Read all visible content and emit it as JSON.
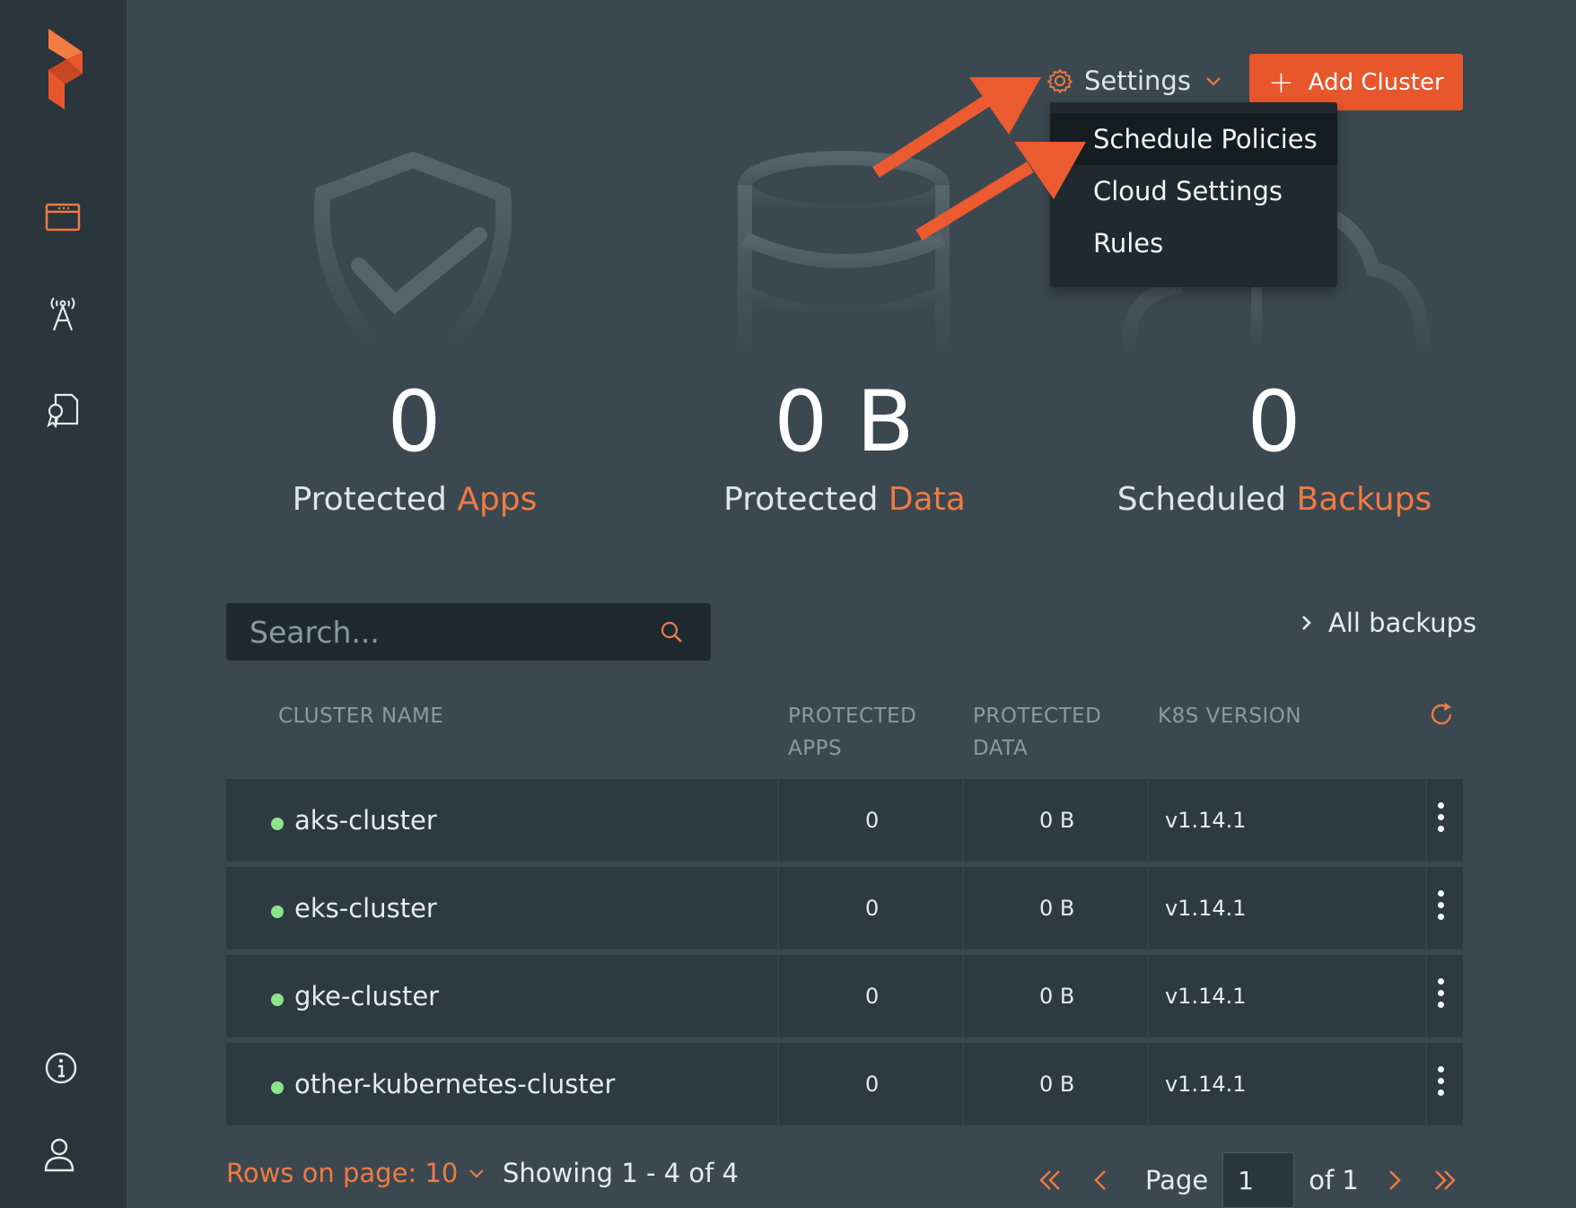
{
  "header": {
    "settings_label": "Settings",
    "add_cluster_label": "Add Cluster"
  },
  "settings_menu": {
    "items": [
      {
        "label": "Schedule Policies"
      },
      {
        "label": "Cloud Settings"
      },
      {
        "label": "Rules"
      }
    ]
  },
  "stats": [
    {
      "value": "0",
      "label_prefix": "Protected ",
      "label_accent": "Apps"
    },
    {
      "value": "0 B",
      "label_prefix": "Protected ",
      "label_accent": "Data"
    },
    {
      "value": "0",
      "label_prefix": "Scheduled ",
      "label_accent": "Backups"
    }
  ],
  "search": {
    "placeholder": "Search..."
  },
  "all_backups_label": "All backups",
  "table": {
    "headers": {
      "cluster_name": "CLUSTER NAME",
      "protected_apps_1": "PROTECTED",
      "protected_apps_2": "APPS",
      "protected_data_1": "PROTECTED",
      "protected_data_2": "DATA",
      "k8s_version": "K8S VERSION"
    },
    "rows": [
      {
        "name": "aks-cluster",
        "apps": "0",
        "data": "0 B",
        "version": "v1.14.1"
      },
      {
        "name": "eks-cluster",
        "apps": "0",
        "data": "0 B",
        "version": "v1.14.1"
      },
      {
        "name": "gke-cluster",
        "apps": "0",
        "data": "0 B",
        "version": "v1.14.1"
      },
      {
        "name": "other-kubernetes-cluster",
        "apps": "0",
        "data": "0 B",
        "version": "v1.14.1"
      }
    ]
  },
  "footer": {
    "rows_on_page": "Rows on page: 10",
    "showing": "Showing 1 - 4 of 4",
    "page_label": "Page",
    "page_value": "1",
    "of_label": "of 1"
  },
  "colors": {
    "accent": "#e8572b",
    "status_ok": "#8ee48c",
    "background": "#3b4850",
    "sidebar": "#2a353c"
  },
  "icons": [
    "portworx-logo",
    "dashboard-icon",
    "cluster-antenna-icon",
    "certificate-icon",
    "info-icon",
    "user-icon",
    "gear-icon",
    "search-icon",
    "refresh-icon",
    "kebab-icon"
  ]
}
